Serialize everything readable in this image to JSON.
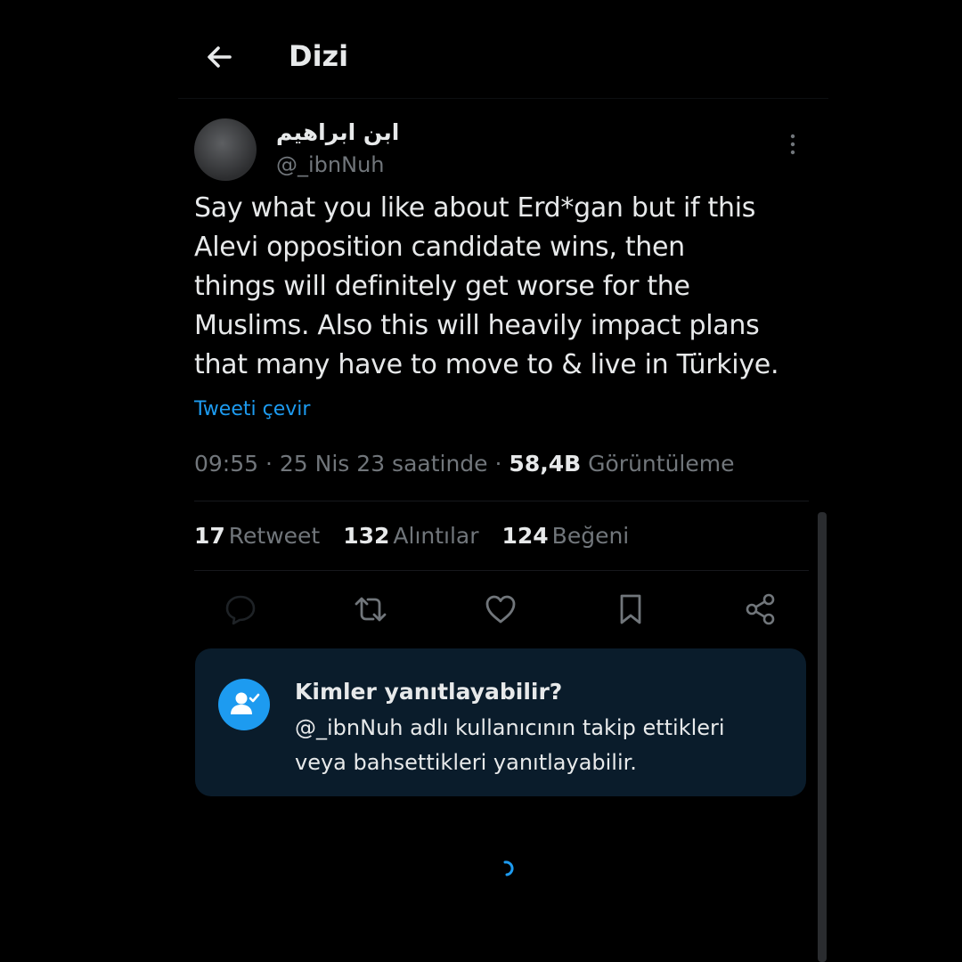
{
  "header": {
    "title": "Dizi",
    "back_icon": "arrow-left-icon"
  },
  "tweet": {
    "author": {
      "display_name": "ابن ابراهيم",
      "handle": "@_ibnNuh"
    },
    "text_lines": [
      "Say what you like about Erd*gan but if this",
      "Alevi opposition candidate wins, then",
      "things will definitely get worse for the",
      "Muslims. Also this will heavily impact plans",
      "that many have to move to & live in Türkiye."
    ],
    "translate_label": "Tweeti çevir",
    "meta": {
      "time": "09:55",
      "separator": "·",
      "date": "25 Nis 23 saatinde",
      "views_count": "58,4B",
      "views_label": "Görüntüleme"
    },
    "stats": {
      "retweets_count": "17",
      "retweets_label": "Retweet",
      "quotes_count": "132",
      "quotes_label": "Alıntılar",
      "likes_count": "124",
      "likes_label": "Beğeni"
    },
    "actions": [
      {
        "name": "reply",
        "icon": "speech-bubble-icon"
      },
      {
        "name": "retweet",
        "icon": "retweet-icon"
      },
      {
        "name": "like",
        "icon": "heart-icon"
      },
      {
        "name": "bookmark",
        "icon": "bookmark-icon"
      },
      {
        "name": "share",
        "icon": "share-icon"
      }
    ]
  },
  "reply_restriction": {
    "title": "Kimler yanıtlayabilir?",
    "description_line1": "@_ibnNuh adlı kullanıcının takip ettikleri",
    "description_line2": "veya bahsettikleri yanıtlayabilir.",
    "icon": "person-check-icon"
  },
  "colors": {
    "background": "#000000",
    "text_primary": "#e7e9ea",
    "text_secondary": "#71767b",
    "accent": "#1d9bf0",
    "card_background": "#0a1c2b"
  }
}
